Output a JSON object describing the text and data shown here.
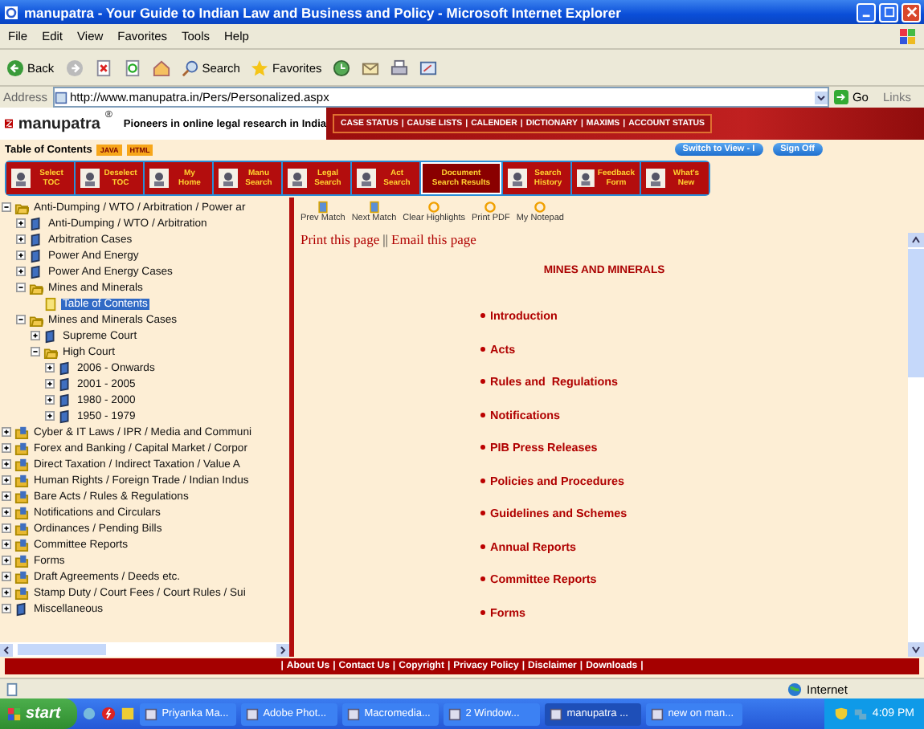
{
  "window": {
    "title": "manupatra - Your Guide to Indian Law and Business and Policy - Microsoft Internet Explorer"
  },
  "menu": [
    "File",
    "Edit",
    "View",
    "Favorites",
    "Tools",
    "Help"
  ],
  "toolbar": {
    "back": "Back",
    "search": "Search",
    "favorites": "Favorites"
  },
  "address_bar": {
    "label": "Address",
    "url": "http://www.manupatra.in/Pers/Personalized.aspx",
    "go": "Go",
    "links": "Links"
  },
  "site_header": {
    "logo": "manupatra",
    "registered": "®",
    "tagline": "Pioneers in online legal research in India",
    "nav_separator": "|",
    "nav": [
      "CASE STATUS",
      "CAUSE LISTS",
      "CALENDER",
      "DICTIONARY",
      "MAXIMS",
      "ACCOUNT STATUS"
    ]
  },
  "toc_bar": {
    "label": "Table of Contents",
    "formats": [
      "JAVA",
      "HTML"
    ],
    "buttons": [
      "Switch to View - I",
      "Sign Off"
    ]
  },
  "main_buttons": [
    {
      "label": "Select TOC",
      "selected": false
    },
    {
      "label": "Deselect TOC",
      "selected": false
    },
    {
      "label": "My Home",
      "selected": false
    },
    {
      "label": "Manu Search",
      "selected": false
    },
    {
      "label": "Legal Search",
      "selected": false
    },
    {
      "label": "Act Search",
      "selected": false
    },
    {
      "label": "Document Search Results",
      "selected": true
    },
    {
      "label": "Search History",
      "selected": false
    },
    {
      "label": "Feedback Form",
      "selected": false
    },
    {
      "label": "What's New",
      "selected": false
    }
  ],
  "tree": [
    {
      "label": "Anti-Dumping / WTO / Arbitration / Power ar",
      "kind": "folder",
      "expanded": true,
      "selected": false,
      "children": [
        {
          "label": "Anti-Dumping / WTO / Arbitration",
          "kind": "book",
          "expanded": false,
          "selected": false
        },
        {
          "label": "Arbitration Cases",
          "kind": "book",
          "expanded": false,
          "selected": false
        },
        {
          "label": "Power And Energy",
          "kind": "book",
          "expanded": false,
          "selected": false
        },
        {
          "label": "Power And Energy Cases",
          "kind": "book",
          "expanded": false,
          "selected": false
        },
        {
          "label": "Mines and Minerals",
          "kind": "folder",
          "expanded": true,
          "selected": false,
          "children": [
            {
              "label": "Table of Contents",
              "kind": "page",
              "selected": true
            }
          ]
        },
        {
          "label": "Mines and Minerals Cases",
          "kind": "folder",
          "expanded": true,
          "selected": false,
          "children": [
            {
              "label": "Supreme Court",
              "kind": "book",
              "expanded": false,
              "selected": false
            },
            {
              "label": "High Court",
              "kind": "folder",
              "expanded": true,
              "selected": false,
              "children": [
                {
                  "label": "2006 - Onwards",
                  "kind": "book",
                  "expanded": false,
                  "selected": false
                },
                {
                  "label": "2001 - 2005",
                  "kind": "book",
                  "expanded": false,
                  "selected": false
                },
                {
                  "label": "1980 - 2000",
                  "kind": "book",
                  "expanded": false,
                  "selected": false
                },
                {
                  "label": "1950 - 1979",
                  "kind": "book",
                  "expanded": false,
                  "selected": false
                }
              ]
            }
          ]
        }
      ]
    },
    {
      "label": "Cyber & IT Laws / IPR / Media and Communi",
      "kind": "docs",
      "expanded": false,
      "selected": false
    },
    {
      "label": "Forex and Banking / Capital Market / Corpor",
      "kind": "docs",
      "expanded": false,
      "selected": false
    },
    {
      "label": "Direct Taxation / Indirect Taxation / Value A",
      "kind": "docs",
      "expanded": false,
      "selected": false
    },
    {
      "label": "Human Rights / Foreign Trade / Indian Indus",
      "kind": "docs",
      "expanded": false,
      "selected": false
    },
    {
      "label": "Bare Acts / Rules & Regulations",
      "kind": "docs",
      "expanded": false,
      "selected": false
    },
    {
      "label": "Notifications and Circulars",
      "kind": "docs",
      "expanded": false,
      "selected": false
    },
    {
      "label": "Ordinances / Pending Bills",
      "kind": "docs",
      "expanded": false,
      "selected": false
    },
    {
      "label": "Committee Reports",
      "kind": "docs",
      "expanded": false,
      "selected": false
    },
    {
      "label": "Forms",
      "kind": "docs",
      "expanded": false,
      "selected": false
    },
    {
      "label": "Draft Agreements / Deeds etc.",
      "kind": "docs",
      "expanded": false,
      "selected": false
    },
    {
      "label": "Stamp Duty / Court Fees / Court Rules / Sui",
      "kind": "docs",
      "expanded": false,
      "selected": false
    },
    {
      "label": "Miscellaneous",
      "kind": "book",
      "expanded": false,
      "selected": false
    }
  ],
  "content_tools": [
    {
      "label": "Prev Match",
      "kind": "doc"
    },
    {
      "label": "Next Match",
      "kind": "doc"
    },
    {
      "label": "Clear Highlights",
      "kind": "ring"
    },
    {
      "label": "Print PDF",
      "kind": "ring"
    },
    {
      "label": "My Notepad",
      "kind": "ring"
    }
  ],
  "page_links": {
    "print": "Print this page",
    "separator": "||",
    "email": "Email this page"
  },
  "heading": "MINES AND MINERALS",
  "sections": [
    "Introduction",
    "Acts",
    "Rules and  Regulations",
    "Notifications",
    "PIB Press Releases",
    "Policies and Procedures",
    "Guidelines and Schemes",
    "Annual Reports",
    "Committee Reports",
    "Forms"
  ],
  "footer": {
    "separator": "|",
    "links": [
      "About Us",
      "Contact Us",
      "Copyright",
      "Privacy Policy",
      "Disclaimer",
      "Downloads"
    ]
  },
  "status_bar": {
    "zone": "Internet"
  },
  "taskbar": {
    "start": "start",
    "tasks": [
      {
        "label": "Priyanka Ma...",
        "selected": false
      },
      {
        "label": "Adobe Phot...",
        "selected": false
      },
      {
        "label": "Macromedia...",
        "selected": false
      },
      {
        "label": "2 Window...",
        "selected": false
      },
      {
        "label": "manupatra ...",
        "selected": true
      },
      {
        "label": "new on man...",
        "selected": false
      }
    ],
    "clock": "4:09 PM"
  }
}
